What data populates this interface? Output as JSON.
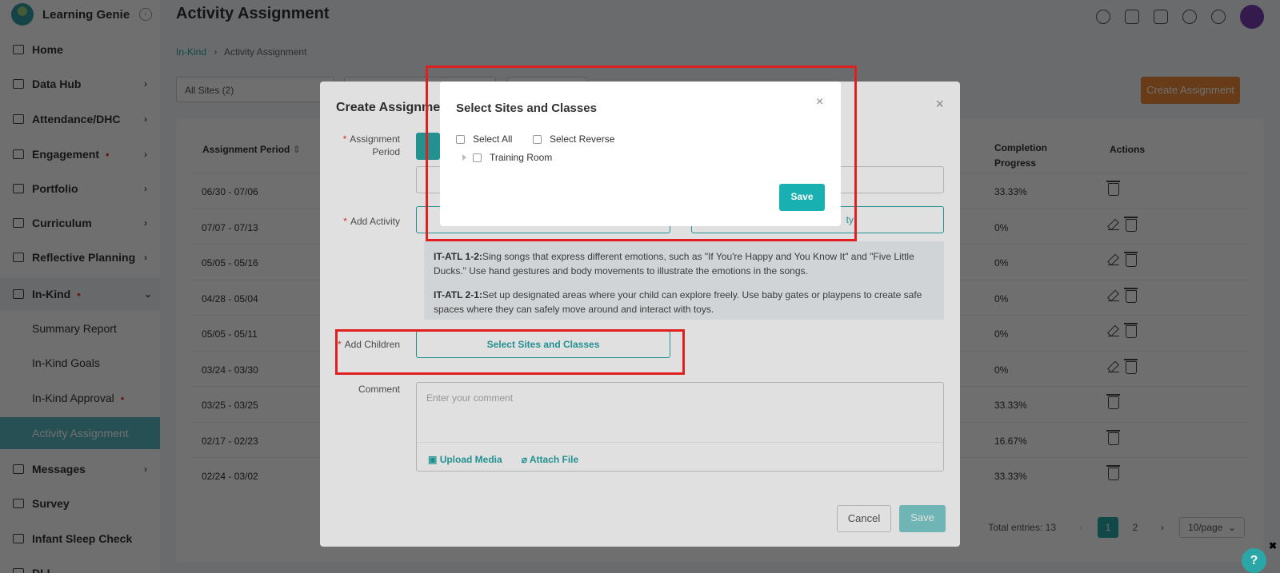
{
  "app": {
    "name": "Learning Genie"
  },
  "sidebar": {
    "items": [
      {
        "label": "Home",
        "icon": "home-icon",
        "dot": "",
        "chev": ""
      },
      {
        "label": "Data Hub",
        "icon": "chart-icon",
        "dot": "",
        "chev": "›"
      },
      {
        "label": "Attendance/DHC",
        "icon": "calendar-icon",
        "dot": "",
        "chev": "›"
      },
      {
        "label": "Engagement",
        "icon": "engagement-icon",
        "dot": "•",
        "chev": "›"
      },
      {
        "label": "Portfolio",
        "icon": "portfolio-icon",
        "dot": "",
        "chev": "›"
      },
      {
        "label": "Curriculum",
        "icon": "curriculum-icon",
        "dot": "",
        "chev": "›"
      },
      {
        "label": "Reflective Planning",
        "icon": "planning-icon",
        "dot": "",
        "chev": "›"
      },
      {
        "label": "In-Kind",
        "icon": "inkind-icon",
        "dot": "•",
        "chev": "⌄"
      },
      {
        "label": "Summary Report",
        "sub": true
      },
      {
        "label": "In-Kind Goals",
        "sub": true
      },
      {
        "label": "In-Kind Approval",
        "sub": true,
        "dot": "•"
      },
      {
        "label": "Activity Assignment",
        "sub": true,
        "active": true
      },
      {
        "label": "Messages",
        "icon": "message-icon",
        "dot": "",
        "chev": "›"
      },
      {
        "label": "Survey",
        "icon": "survey-icon",
        "dot": "",
        "chev": ""
      },
      {
        "label": "Infant Sleep Check",
        "icon": "clock-icon",
        "dot": "",
        "chev": ""
      },
      {
        "label": "DLL",
        "icon": "dll-icon",
        "dot": "",
        "chev": ""
      }
    ]
  },
  "header": {
    "title": "Activity Assignment"
  },
  "breadcrumb": {
    "parent": "In-Kind",
    "sep": "›",
    "current": "Activity Assignment"
  },
  "filters": {
    "sites": "All Sites  (2)"
  },
  "toolbar": {
    "create_label": "Create Assignment"
  },
  "table": {
    "headers": {
      "period": "Assignment Period",
      "progress": "Completion Progress",
      "actions": "Actions"
    },
    "rows": [
      {
        "period": "06/30 - 07/06",
        "progress": "33.33%",
        "edit": false
      },
      {
        "period": "07/07 - 07/13",
        "progress": "0%",
        "edit": true
      },
      {
        "period": "05/05 - 05/16",
        "progress": "0%",
        "edit": true
      },
      {
        "period": "04/28 - 05/04",
        "progress": "0%",
        "edit": true
      },
      {
        "period": "05/05 - 05/11",
        "progress": "0%",
        "edit": true
      },
      {
        "period": "03/24 - 03/30",
        "progress": "0%",
        "edit": true
      },
      {
        "period": "03/25 - 03/25",
        "progress": "33.33%",
        "edit": false
      },
      {
        "period": "02/17 - 02/23",
        "progress": "16.67%",
        "edit": false
      },
      {
        "period": "02/24 - 03/02",
        "progress": "33.33%",
        "edit": false
      }
    ],
    "total": "Total entries: 13",
    "pages": [
      "‹",
      "1",
      "2",
      "›"
    ],
    "page_size": "10/page"
  },
  "create_dialog": {
    "title": "Create Assignment",
    "close": "×",
    "period_label": "Assignment Period",
    "activity_label": "Add Activity",
    "activity_btn2": "ty",
    "activities": [
      {
        "code": "IT-ATL 1-2:",
        "text": "Sing songs that express different emotions, such as \"If You're Happy and You Know It\" and \"Five Little Ducks.\" Use hand gestures and body movements to illustrate the emotions in the songs."
      },
      {
        "code": "IT-ATL 2-1:",
        "text": "Set up designated areas where your child can explore freely. Use baby gates or playpens to create safe spaces where they can safely move around and interact with toys."
      }
    ],
    "children_label": "Add Children",
    "select_btn": "Select Sites and Classes",
    "comment_label": "Comment",
    "comment_placeholder": "Enter your comment",
    "upload_label": "Upload Media",
    "attach_label": "Attach File",
    "cancel_label": "Cancel",
    "save_label": "Save"
  },
  "select_dialog": {
    "title": "Select Sites and Classes",
    "close": "×",
    "select_all": "Select All",
    "select_reverse": "Select Reverse",
    "tree_item": "Training Room",
    "save_label": "Save"
  },
  "help": {
    "label": "?",
    "close": "✖"
  },
  "colors": {
    "teal": "#2aa6a6",
    "highlight": "#e02020",
    "accent": "#ef8b3a"
  }
}
